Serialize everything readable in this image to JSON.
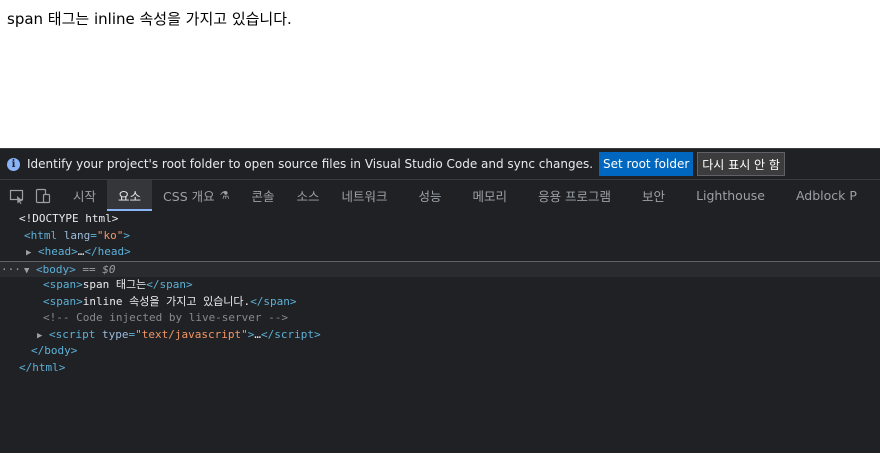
{
  "page": {
    "text": "span 태그는 inline 속성을 가지고 있습니다."
  },
  "infobar": {
    "message": "Identify your project's root folder to open source files in Visual Studio Code and sync changes.",
    "set_root_label": "Set root folder",
    "dismiss_label": "다시 표시 안 함"
  },
  "toolbar": {
    "tabs": [
      {
        "label": "시작"
      },
      {
        "label": "요소"
      },
      {
        "label": "CSS 개요"
      },
      {
        "label": "콘솔"
      },
      {
        "label": "소스"
      },
      {
        "label": "네트워크"
      },
      {
        "label": "성능"
      },
      {
        "label": "메모리"
      },
      {
        "label": "응용 프로그램"
      },
      {
        "label": "보안"
      },
      {
        "label": "Lighthouse"
      },
      {
        "label": "Adblock P"
      }
    ],
    "active_tab": "요소",
    "icons": [
      "inspect-element-icon",
      "device-toolbar-icon",
      "flask-icon"
    ]
  },
  "dom": {
    "doctype": "<!DOCTYPE html>",
    "html_open": "html",
    "html_attr": "lang",
    "html_attr_val": "\"ko\"",
    "head": "head",
    "ellipsis": "…",
    "body": "body",
    "selected_marker": "== $0",
    "span1_text": "span 태그는",
    "span2_text": "inline 속성을 가지고 있습니다.",
    "comment": "<!-- Code injected by live-server -->",
    "script_attr": "type",
    "script_attr_val": "\"text/javascript\"",
    "dots": "···"
  },
  "colors": {
    "devtools_bg": "#202124",
    "accent": "#0067c0",
    "active_tab_underline": "#8ab4f8",
    "tag": "#5db0d7",
    "attr_value": "#f29766",
    "comment": "#898989"
  }
}
